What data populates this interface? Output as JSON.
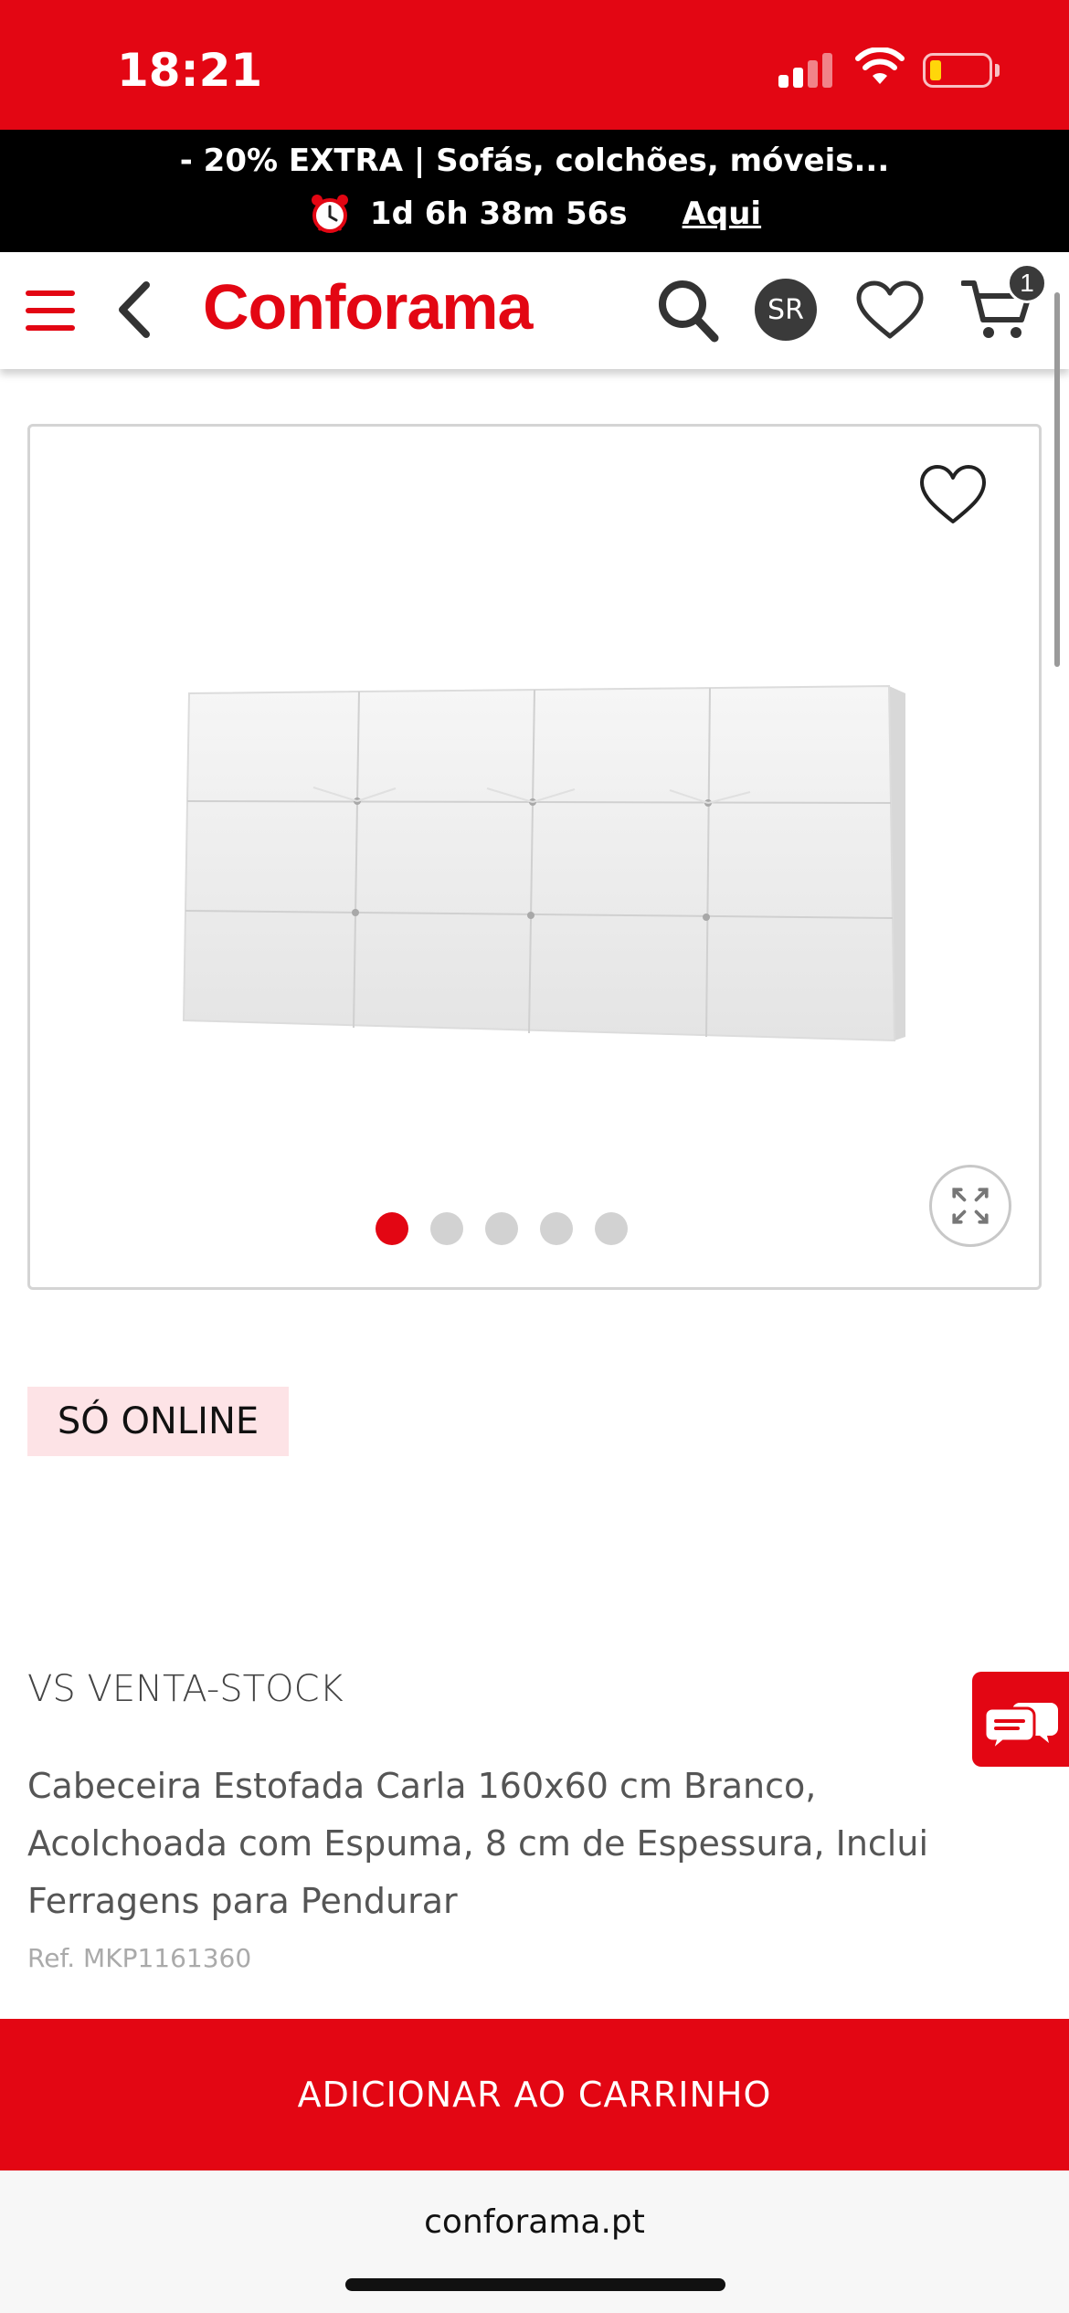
{
  "status_bar": {
    "time": "18:21"
  },
  "promo": {
    "headline": "- 20% EXTRA | Sofás, colchões, móveis...",
    "countdown": "1d 6h 38m 56s",
    "link_label": "Aqui",
    "icon": "alarm-clock-icon"
  },
  "header": {
    "logo": "Conforama",
    "avatar_initials": "SR",
    "cart_count": "1",
    "accent_color": "#e30613"
  },
  "gallery": {
    "image_count": 5,
    "active_index": 0,
    "image_alt": "white tufted upholstered headboard"
  },
  "product": {
    "badge": "SÓ ONLINE",
    "brand": "VS VENTA-STOCK",
    "title": "Cabeceira Estofada Carla 160x60 cm Branco, Acolchoada com Espuma, 8 cm de Espessura, Inclui Ferragens para Pendurar",
    "ref": "Ref. MKP1161360"
  },
  "actions": {
    "add_to_cart": "ADICIONAR AO CARRINHO"
  },
  "browser": {
    "url": "conforama.pt"
  }
}
